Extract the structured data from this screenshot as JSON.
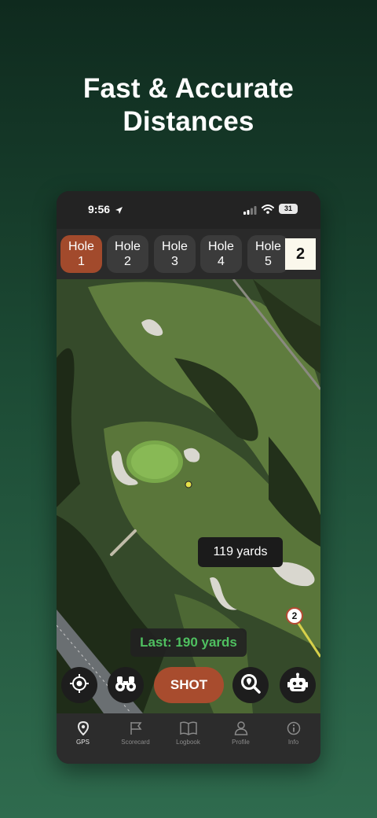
{
  "headline": {
    "line1": "Fast & Accurate",
    "line2": "Distances"
  },
  "status_bar": {
    "time": "9:56",
    "battery": "31",
    "icons": [
      "location-arrow-icon",
      "signal-icon",
      "wifi-icon",
      "battery-icon"
    ]
  },
  "holes": [
    {
      "label": "Hole",
      "number": "1",
      "active": true
    },
    {
      "label": "Hole",
      "number": "2",
      "active": false
    },
    {
      "label": "Hole",
      "number": "3",
      "active": false
    },
    {
      "label": "Hole",
      "number": "4",
      "active": false
    },
    {
      "label": "Hole",
      "number": "5",
      "active": false
    }
  ],
  "hole_count": "2",
  "map": {
    "distance_label": "119 yards",
    "last_shot_label": "Last: 190 yards",
    "marker_number": "2"
  },
  "actions": {
    "locate_icon": "crosshair-icon",
    "binoculars_icon": "binoculars-icon",
    "shot_label": "SHOT",
    "search_icon": "map-search-icon",
    "assistant_icon": "robot-icon"
  },
  "tabs": [
    {
      "label": "GPS",
      "icon": "map-pin-icon",
      "active": true
    },
    {
      "label": "Scorecard",
      "icon": "flag-icon",
      "active": false
    },
    {
      "label": "Logbook",
      "icon": "book-icon",
      "active": false
    },
    {
      "label": "Profile",
      "icon": "person-icon",
      "active": false
    },
    {
      "label": "Info",
      "icon": "info-icon",
      "active": false
    }
  ],
  "colors": {
    "accent": "#a24a2c",
    "last_shot_text": "#4fc060",
    "background_top": "#0f2a1e",
    "background_bottom": "#2f6b4e"
  }
}
